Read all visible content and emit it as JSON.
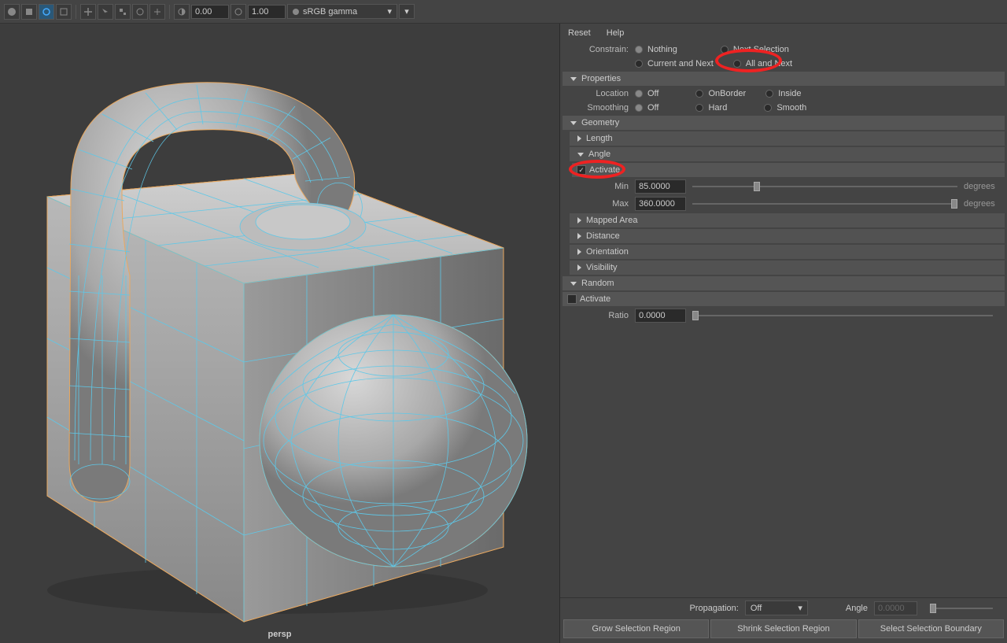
{
  "toolbar": {
    "val1": "0.00",
    "val2": "1.00",
    "colorspace": "sRGB gamma"
  },
  "viewport": {
    "camera": "persp"
  },
  "menu": {
    "reset": "Reset",
    "help": "Help"
  },
  "constrain": {
    "label": "Constrain:",
    "opt_nothing": "Nothing",
    "opt_next_selection": "Next Selection",
    "opt_current_and_next": "Current and Next",
    "opt_all_and_next": "All and Next"
  },
  "properties": {
    "header": "Properties",
    "location_label": "Location",
    "loc_off": "Off",
    "loc_onborder": "OnBorder",
    "loc_inside": "Inside",
    "smoothing_label": "Smoothing",
    "sm_off": "Off",
    "sm_hard": "Hard",
    "sm_smooth": "Smooth"
  },
  "geometry": {
    "header": "Geometry",
    "length": "Length",
    "angle": "Angle",
    "activate": "Activate",
    "min_label": "Min",
    "min_val": "85.0000",
    "max_label": "Max",
    "max_val": "360.0000",
    "unit": "degrees",
    "mapped_area": "Mapped Area",
    "distance": "Distance",
    "orientation": "Orientation",
    "visibility": "Visibility"
  },
  "random": {
    "header": "Random",
    "activate": "Activate",
    "ratio_label": "Ratio",
    "ratio_val": "0.0000"
  },
  "footer": {
    "propagation_label": "Propagation:",
    "propagation_val": "Off",
    "angle_label": "Angle",
    "angle_val": "0.0000",
    "grow": "Grow Selection Region",
    "shrink": "Shrink Selection Region",
    "boundary": "Select Selection Boundary"
  }
}
